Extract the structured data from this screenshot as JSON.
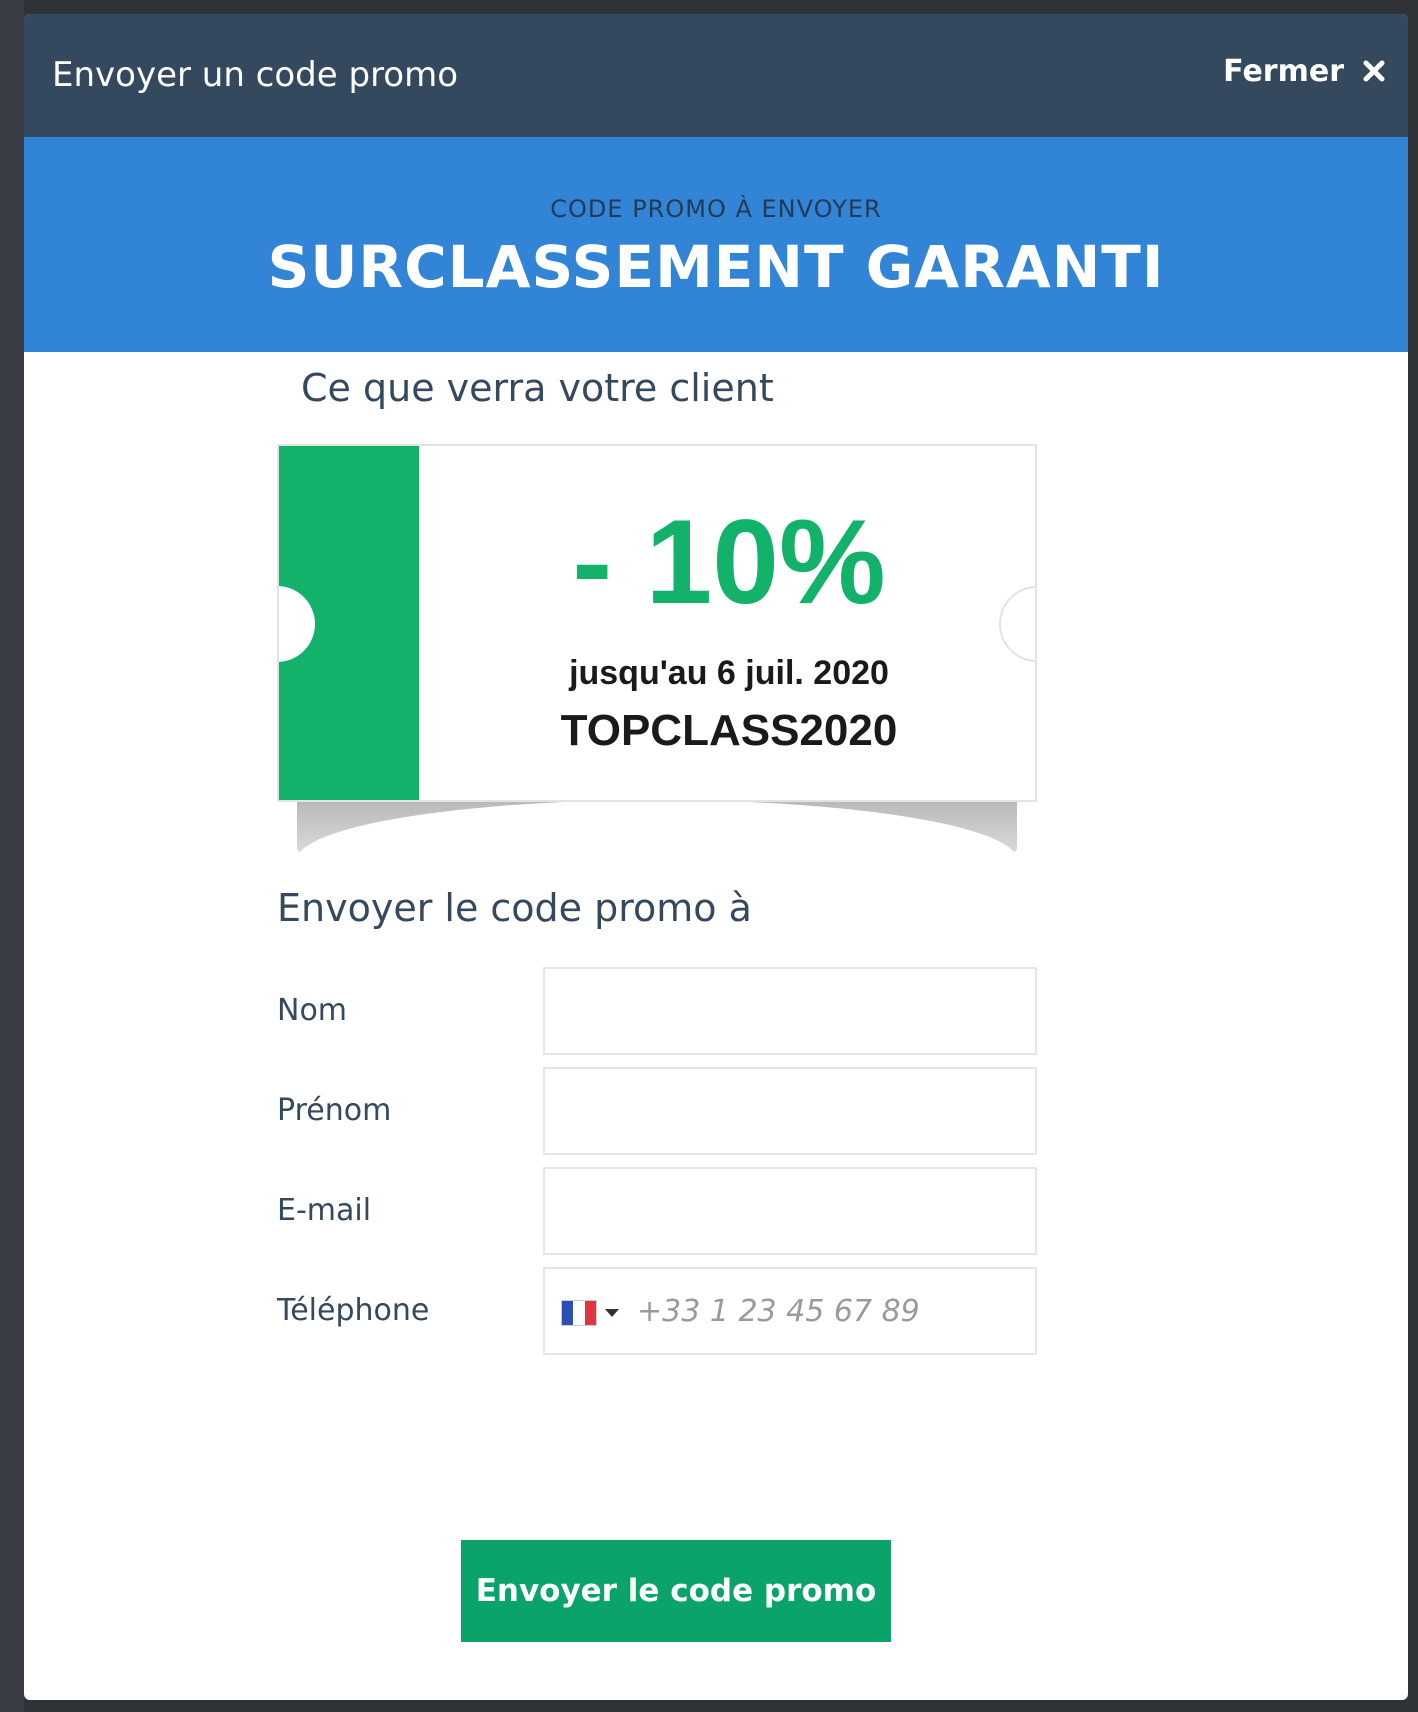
{
  "modal": {
    "title": "Envoyer un code promo",
    "close_label": "Fermer",
    "close_icon": "close-icon"
  },
  "hero": {
    "kicker": "CODE PROMO À ENVOYER",
    "title": "SURCLASSEMENT GARANTI"
  },
  "preview": {
    "heading": "Ce que verra votre client",
    "discount": "- 10%",
    "validity": "jusqu'au 6 juil. 2020",
    "code": "TOPCLASS2020"
  },
  "form": {
    "heading": "Envoyer le code promo à",
    "fields": [
      {
        "label": "Nom",
        "value": ""
      },
      {
        "label": "Prénom",
        "value": ""
      },
      {
        "label": "E-mail",
        "value": ""
      },
      {
        "label": "Téléphone",
        "placeholder": "+33 1 23 45 67 89",
        "country_flag": "france-flag-icon"
      }
    ],
    "submit_label": "Envoyer le code promo"
  },
  "colors": {
    "header_bg": "#34495e",
    "hero_bg": "#3284d6",
    "accent_green": "#13b26b",
    "button_green": "#0aa46a"
  }
}
